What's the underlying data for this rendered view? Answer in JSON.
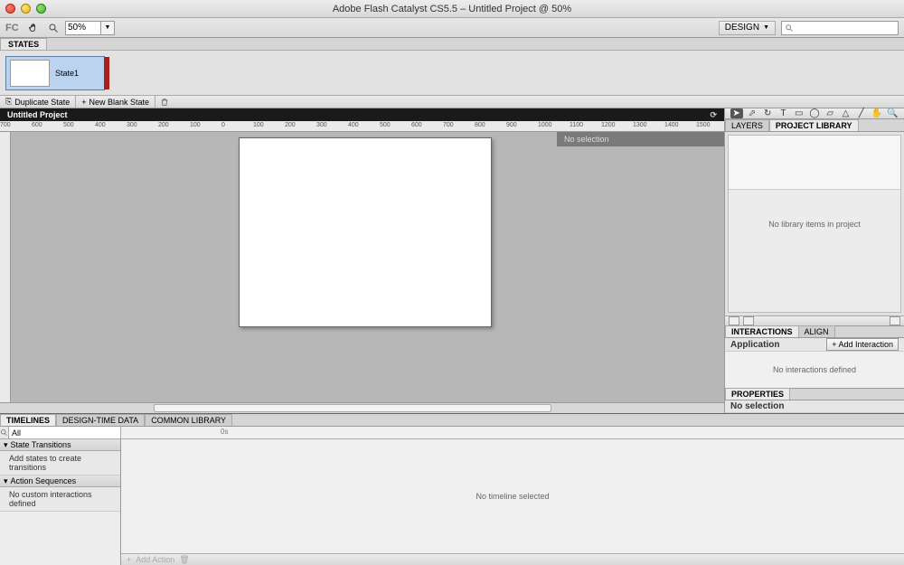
{
  "title": "Adobe Flash Catalyst CS5.5 – Untitled Project @ 50%",
  "toolbar": {
    "fc_logo": "FC",
    "zoom": "50%",
    "workspace": "DESIGN"
  },
  "states": {
    "tab": "STATES",
    "items": [
      {
        "label": "State1"
      }
    ],
    "duplicate": "Duplicate State",
    "newblank": "New Blank State"
  },
  "project": {
    "name": "Untitled Project",
    "no_selection": "No selection"
  },
  "ruler_marks": [
    "-700",
    "-600",
    "-500",
    "-400",
    "-300",
    "-200",
    "-100",
    "0",
    "100",
    "200",
    "300",
    "400",
    "500",
    "600",
    "700",
    "800",
    "900",
    "1000",
    "1100",
    "1200",
    "1300",
    "1400",
    "1500"
  ],
  "right": {
    "tabs": {
      "layers": "LAYERS",
      "library": "PROJECT LIBRARY"
    },
    "library_empty": "No library items in project",
    "interactions": {
      "tab": "INTERACTIONS",
      "align_tab": "ALIGN",
      "subject": "Application",
      "add": "+ Add Interaction",
      "empty": "No interactions defined"
    },
    "properties": {
      "tab": "PROPERTIES",
      "text": "No selection"
    }
  },
  "bottom": {
    "tabs": {
      "timelines": "TIMELINES",
      "designtime": "DESIGN-TIME DATA",
      "common": "COMMON LIBRARY"
    },
    "filter": "All",
    "section_transitions": "State Transitions",
    "transitions_hint": "Add states to create transitions",
    "section_actions": "Action Sequences",
    "actions_hint": "No custom interactions defined",
    "timeline_empty": "No timeline selected",
    "timeline_zero": "0s",
    "add_action": "Add Action"
  }
}
